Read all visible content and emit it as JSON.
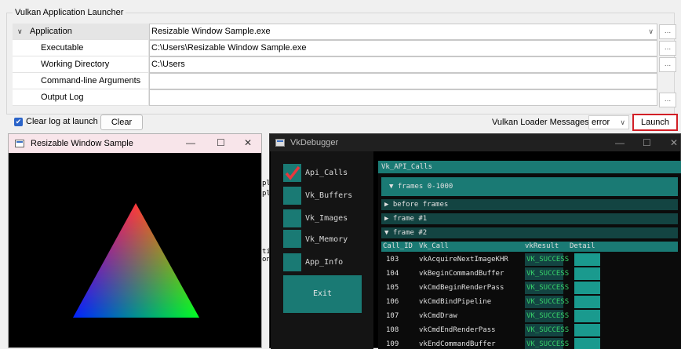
{
  "launcher": {
    "title": "Vulkan Application Launcher",
    "rows": [
      {
        "label": "Application",
        "value": "Resizable Window Sample.exe"
      },
      {
        "label": "Executable",
        "value": "C:\\Users\\Resizable Window Sample.exe"
      },
      {
        "label": "Working Directory",
        "value": "C:\\Users"
      },
      {
        "label": "Command-line Arguments",
        "value": ""
      },
      {
        "label": "Output Log",
        "value": ""
      }
    ],
    "browse_label": "...",
    "clear_log_label": "Clear log at launch",
    "clear_log_checked": true,
    "clear_button": "Clear",
    "loader_label": "Vulkan Loader Messages:",
    "loader_value": "error",
    "launch_button": "Launch",
    "colors": {
      "launch_border": "#d21f26",
      "checkbox": "#2b64c9"
    }
  },
  "sample_window": {
    "title": "Resizable Window Sample",
    "controls": {
      "minimize": "—",
      "maximize": "☐",
      "close": "✕"
    },
    "triangle_colors": [
      "#ff0000",
      "#00ff00",
      "#0000ff"
    ]
  },
  "vkdebugger": {
    "title": "VkDebugger",
    "controls": {
      "minimize": "—",
      "maximize": "☐",
      "close": "✕"
    },
    "checkboxes": [
      {
        "label": "Api_Calls",
        "checked": true
      },
      {
        "label": "Vk_Buffers",
        "checked": false
      },
      {
        "label": "Vk_Images",
        "checked": false
      },
      {
        "label": "Vk_Memory",
        "checked": false
      },
      {
        "label": "App_Info",
        "checked": false
      }
    ],
    "exit_button": "Exit",
    "panel_title": "Vk_API_Calls",
    "frames_node": "▼  frames 0-1000",
    "nodes": [
      "▶ before frames",
      "▶ frame #1",
      "▼ frame #2"
    ],
    "columns": [
      "Call_ID",
      "Vk_Call",
      "vkResult",
      "Detail"
    ],
    "calls": [
      {
        "id": "103",
        "call": "vkAcquireNextImageKHR",
        "result": "VK_SUCCESS"
      },
      {
        "id": "104",
        "call": "vkBeginCommandBuffer",
        "result": "VK_SUCCESS"
      },
      {
        "id": "105",
        "call": "vkCmdBeginRenderPass",
        "result": "VK_SUCCESS"
      },
      {
        "id": "106",
        "call": "vkCmdBindPipeline",
        "result": "VK_SUCCESS"
      },
      {
        "id": "107",
        "call": "vkCmdDraw",
        "result": "VK_SUCCESS"
      },
      {
        "id": "108",
        "call": "vkCmdEndRenderPass",
        "result": "VK_SUCCESS"
      },
      {
        "id": "109",
        "call": "vkEndCommandBuffer",
        "result": "VK_SUCCESS"
      }
    ],
    "colors": {
      "accent": "#1a7a74",
      "success": "#37d26a",
      "check": "#e8373d"
    }
  },
  "background_fragments": [
    "pl",
    "pl",
    "ti",
    "on"
  ]
}
